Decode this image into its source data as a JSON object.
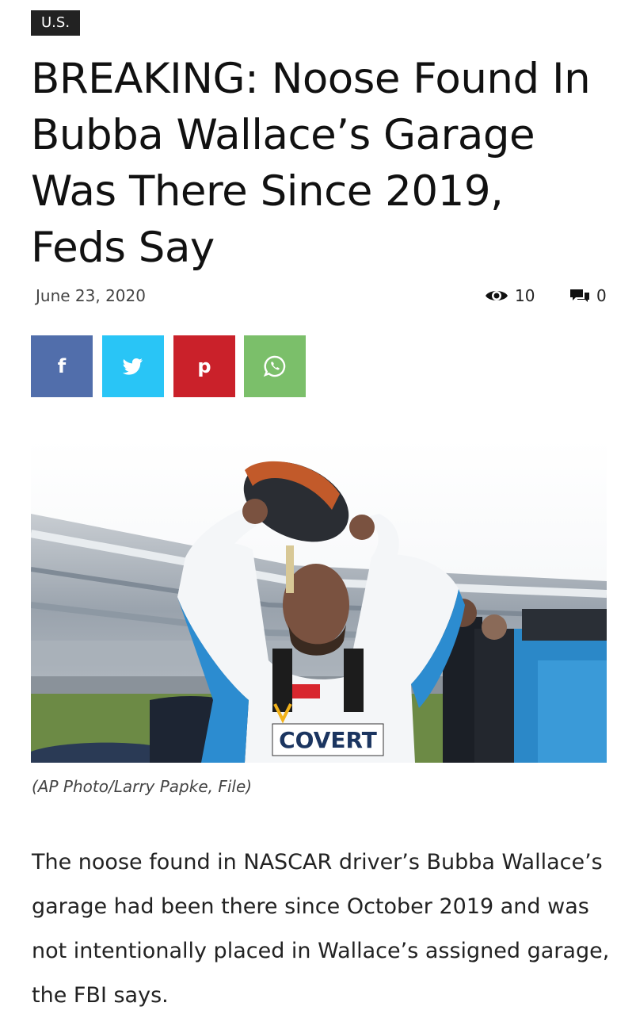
{
  "article": {
    "category": "U.S.",
    "title": "BREAKING: Noose Found In Bubba Wallace’s Garage Was There Since 2019, Feds Say",
    "date": "June 23, 2020",
    "views": "10",
    "comments": "0",
    "photo_caption": "(AP Photo/Larry Papke, File)",
    "photo_suit_text": "COVERT",
    "body": "The noose found in NASCAR driver’s Bubba Wallace’s garage had been there since October 2019 and was not intentionally placed in Wallace’s assigned garage, the FBI says."
  },
  "share": {
    "facebook": "f",
    "twitter_icon": "twitter-bird-icon",
    "pinterest": "p",
    "whatsapp_icon": "whatsapp-icon"
  },
  "colors": {
    "category_bg": "#222222",
    "facebook": "#516eab",
    "twitter": "#29c5f6",
    "pinterest": "#ca212a",
    "whatsapp": "#7bbf6a"
  }
}
